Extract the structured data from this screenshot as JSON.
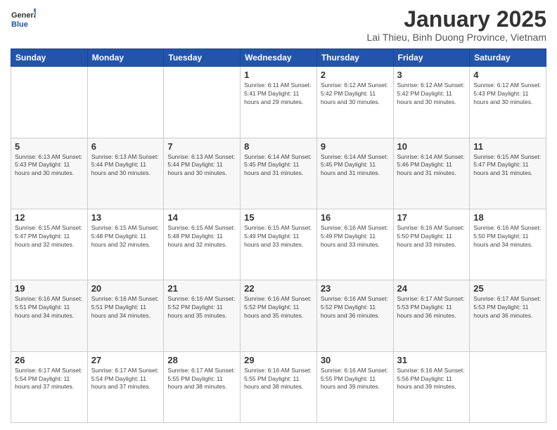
{
  "logo": {
    "general": "General",
    "blue": "Blue"
  },
  "header": {
    "title": "January 2025",
    "subtitle": "Lai Thieu, Binh Duong Province, Vietnam"
  },
  "days_of_week": [
    "Sunday",
    "Monday",
    "Tuesday",
    "Wednesday",
    "Thursday",
    "Friday",
    "Saturday"
  ],
  "weeks": [
    [
      {
        "day": "",
        "info": ""
      },
      {
        "day": "",
        "info": ""
      },
      {
        "day": "",
        "info": ""
      },
      {
        "day": "1",
        "info": "Sunrise: 6:11 AM\nSunset: 5:41 PM\nDaylight: 11 hours and 29 minutes."
      },
      {
        "day": "2",
        "info": "Sunrise: 6:12 AM\nSunset: 5:42 PM\nDaylight: 11 hours and 30 minutes."
      },
      {
        "day": "3",
        "info": "Sunrise: 6:12 AM\nSunset: 5:42 PM\nDaylight: 11 hours and 30 minutes."
      },
      {
        "day": "4",
        "info": "Sunrise: 6:12 AM\nSunset: 5:43 PM\nDaylight: 11 hours and 30 minutes."
      }
    ],
    [
      {
        "day": "5",
        "info": "Sunrise: 6:13 AM\nSunset: 5:43 PM\nDaylight: 11 hours and 30 minutes."
      },
      {
        "day": "6",
        "info": "Sunrise: 6:13 AM\nSunset: 5:44 PM\nDaylight: 11 hours and 30 minutes."
      },
      {
        "day": "7",
        "info": "Sunrise: 6:13 AM\nSunset: 5:44 PM\nDaylight: 11 hours and 30 minutes."
      },
      {
        "day": "8",
        "info": "Sunrise: 6:14 AM\nSunset: 5:45 PM\nDaylight: 11 hours and 31 minutes."
      },
      {
        "day": "9",
        "info": "Sunrise: 6:14 AM\nSunset: 5:45 PM\nDaylight: 11 hours and 31 minutes."
      },
      {
        "day": "10",
        "info": "Sunrise: 6:14 AM\nSunset: 5:46 PM\nDaylight: 11 hours and 31 minutes."
      },
      {
        "day": "11",
        "info": "Sunrise: 6:15 AM\nSunset: 5:47 PM\nDaylight: 11 hours and 31 minutes."
      }
    ],
    [
      {
        "day": "12",
        "info": "Sunrise: 6:15 AM\nSunset: 5:47 PM\nDaylight: 11 hours and 32 minutes."
      },
      {
        "day": "13",
        "info": "Sunrise: 6:15 AM\nSunset: 5:48 PM\nDaylight: 11 hours and 32 minutes."
      },
      {
        "day": "14",
        "info": "Sunrise: 6:15 AM\nSunset: 5:48 PM\nDaylight: 11 hours and 32 minutes."
      },
      {
        "day": "15",
        "info": "Sunrise: 6:15 AM\nSunset: 5:49 PM\nDaylight: 11 hours and 33 minutes."
      },
      {
        "day": "16",
        "info": "Sunrise: 6:16 AM\nSunset: 5:49 PM\nDaylight: 11 hours and 33 minutes."
      },
      {
        "day": "17",
        "info": "Sunrise: 6:16 AM\nSunset: 5:50 PM\nDaylight: 11 hours and 33 minutes."
      },
      {
        "day": "18",
        "info": "Sunrise: 6:16 AM\nSunset: 5:50 PM\nDaylight: 11 hours and 34 minutes."
      }
    ],
    [
      {
        "day": "19",
        "info": "Sunrise: 6:16 AM\nSunset: 5:51 PM\nDaylight: 11 hours and 34 minutes."
      },
      {
        "day": "20",
        "info": "Sunrise: 6:16 AM\nSunset: 5:51 PM\nDaylight: 11 hours and 34 minutes."
      },
      {
        "day": "21",
        "info": "Sunrise: 6:16 AM\nSunset: 5:52 PM\nDaylight: 11 hours and 35 minutes."
      },
      {
        "day": "22",
        "info": "Sunrise: 6:16 AM\nSunset: 5:52 PM\nDaylight: 11 hours and 35 minutes."
      },
      {
        "day": "23",
        "info": "Sunrise: 6:16 AM\nSunset: 5:52 PM\nDaylight: 11 hours and 36 minutes."
      },
      {
        "day": "24",
        "info": "Sunrise: 6:17 AM\nSunset: 5:53 PM\nDaylight: 11 hours and 36 minutes."
      },
      {
        "day": "25",
        "info": "Sunrise: 6:17 AM\nSunset: 5:53 PM\nDaylight: 11 hours and 36 minutes."
      }
    ],
    [
      {
        "day": "26",
        "info": "Sunrise: 6:17 AM\nSunset: 5:54 PM\nDaylight: 11 hours and 37 minutes."
      },
      {
        "day": "27",
        "info": "Sunrise: 6:17 AM\nSunset: 5:54 PM\nDaylight: 11 hours and 37 minutes."
      },
      {
        "day": "28",
        "info": "Sunrise: 6:17 AM\nSunset: 5:55 PM\nDaylight: 11 hours and 38 minutes."
      },
      {
        "day": "29",
        "info": "Sunrise: 6:16 AM\nSunset: 5:55 PM\nDaylight: 11 hours and 38 minutes."
      },
      {
        "day": "30",
        "info": "Sunrise: 6:16 AM\nSunset: 5:55 PM\nDaylight: 11 hours and 39 minutes."
      },
      {
        "day": "31",
        "info": "Sunrise: 6:16 AM\nSunset: 5:56 PM\nDaylight: 11 hours and 39 minutes."
      },
      {
        "day": "",
        "info": ""
      }
    ]
  ]
}
